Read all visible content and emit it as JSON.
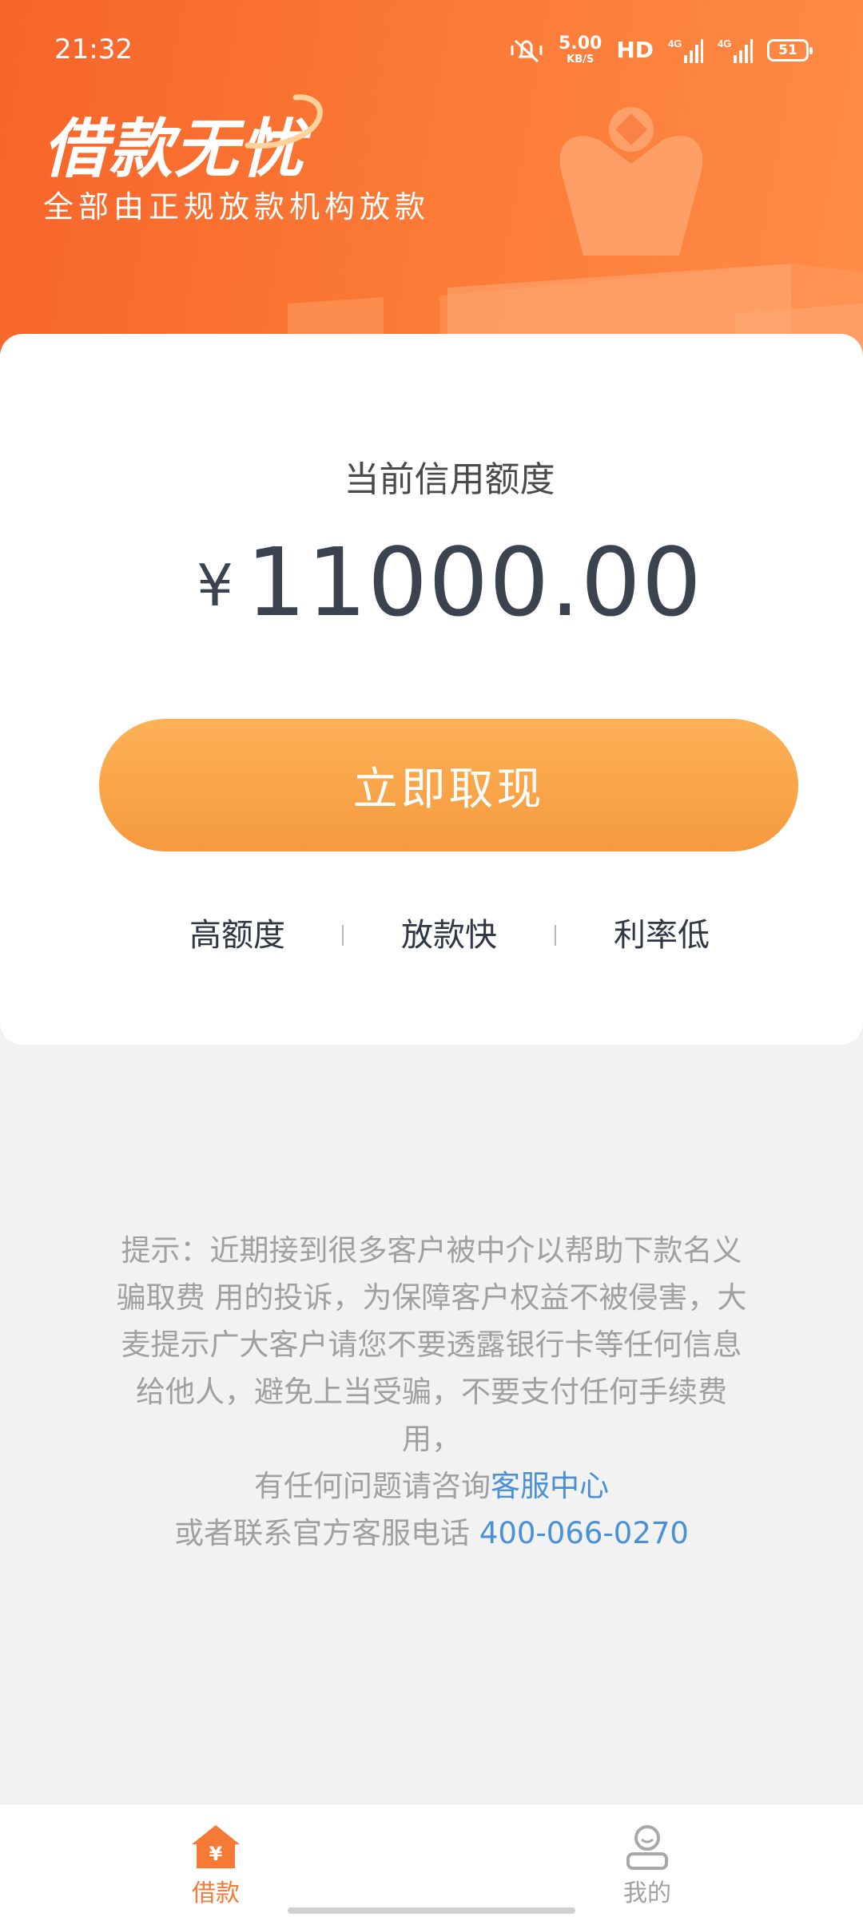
{
  "status_bar": {
    "time": "21:32",
    "net_speed": "5.00",
    "net_unit": "KB/S",
    "hd": "HD",
    "sig1": "4G",
    "sig2": "4G",
    "battery": "51"
  },
  "header": {
    "brand_title": "借款无忧",
    "brand_subtitle": "全部由正规放款机构放款"
  },
  "card": {
    "label": "当前信用额度",
    "currency": "¥",
    "amount": "11000.00",
    "cta_label": "立即取现",
    "features": [
      "高额度",
      "放款快",
      "利率低"
    ]
  },
  "notice": {
    "tip_line1": "提示：近期接到很多客户被中介以帮助下款名义",
    "tip_line2": "骗取费 用的投诉，为保障客户权益不被侵害，大",
    "tip_line3": "麦提示广大客户请您不要透露银行卡等任何信息",
    "tip_line4": "给他人，避免上当受骗，不要支付任何手续费",
    "tip_line5": "用，",
    "consult_prefix": "有任何问题请咨询",
    "consult_link": "客服中心",
    "phone_prefix": "或者联系官方客服电话 ",
    "phone_number": "400-066-0270"
  },
  "tabbar": {
    "tabs": [
      {
        "label": "借款",
        "icon": "loan-home-icon",
        "active": true
      },
      {
        "label": "我的",
        "icon": "profile-icon",
        "active": false
      }
    ]
  },
  "colors": {
    "header_orange": "#f7642a",
    "cta_orange": "#f59a3e",
    "link_blue": "#4a90d9",
    "active_tab": "#f47a36"
  }
}
